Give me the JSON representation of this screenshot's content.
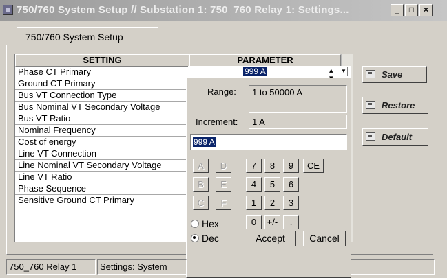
{
  "window": {
    "title_main": "750/760 System Setup // Substation 1: 750_760 Relay 1: Settings...",
    "minimize": "_",
    "maximize": "□",
    "close": "×"
  },
  "tab": {
    "label": "750/760 System Setup"
  },
  "table": {
    "headers": {
      "setting": "SETTING",
      "parameter": "PARAMETER"
    },
    "rows": [
      "Phase CT Primary",
      "Ground CT Primary",
      "Bus VT Connection Type",
      "Bus Nominal VT Secondary Voltage",
      "Bus VT Ratio",
      "Nominal Frequency",
      "Cost of energy",
      "Line VT Connection",
      "Line Nominal VT Secondary Voltage",
      "Line VT Ratio",
      "Phase Sequence",
      "Sensitive Ground CT Primary"
    ],
    "selected_value": "999 A"
  },
  "keypad": {
    "range_label": "Range:",
    "range_value": "1 to 50000 A",
    "increment_label": "Increment:",
    "increment_value": "1 A",
    "entry_value": "999 A",
    "hex_keys": [
      "A",
      "D",
      "B",
      "E",
      "C",
      "F"
    ],
    "num_keys": [
      "7",
      "8",
      "9",
      "4",
      "5",
      "6",
      "1",
      "2",
      "3",
      "0",
      "+/-",
      "."
    ],
    "ce": "CE",
    "hex_label": "Hex",
    "dec_label": "Dec",
    "mode": "Dec",
    "accept": "Accept",
    "cancel": "Cancel"
  },
  "side_buttons": {
    "save": "Save",
    "restore": "Restore",
    "default": "Default"
  },
  "status": {
    "relay": "750_760 Relay 1",
    "section": "Settings: System"
  },
  "colors": {
    "selection": "#0a246a",
    "face": "#d4d0c8"
  }
}
